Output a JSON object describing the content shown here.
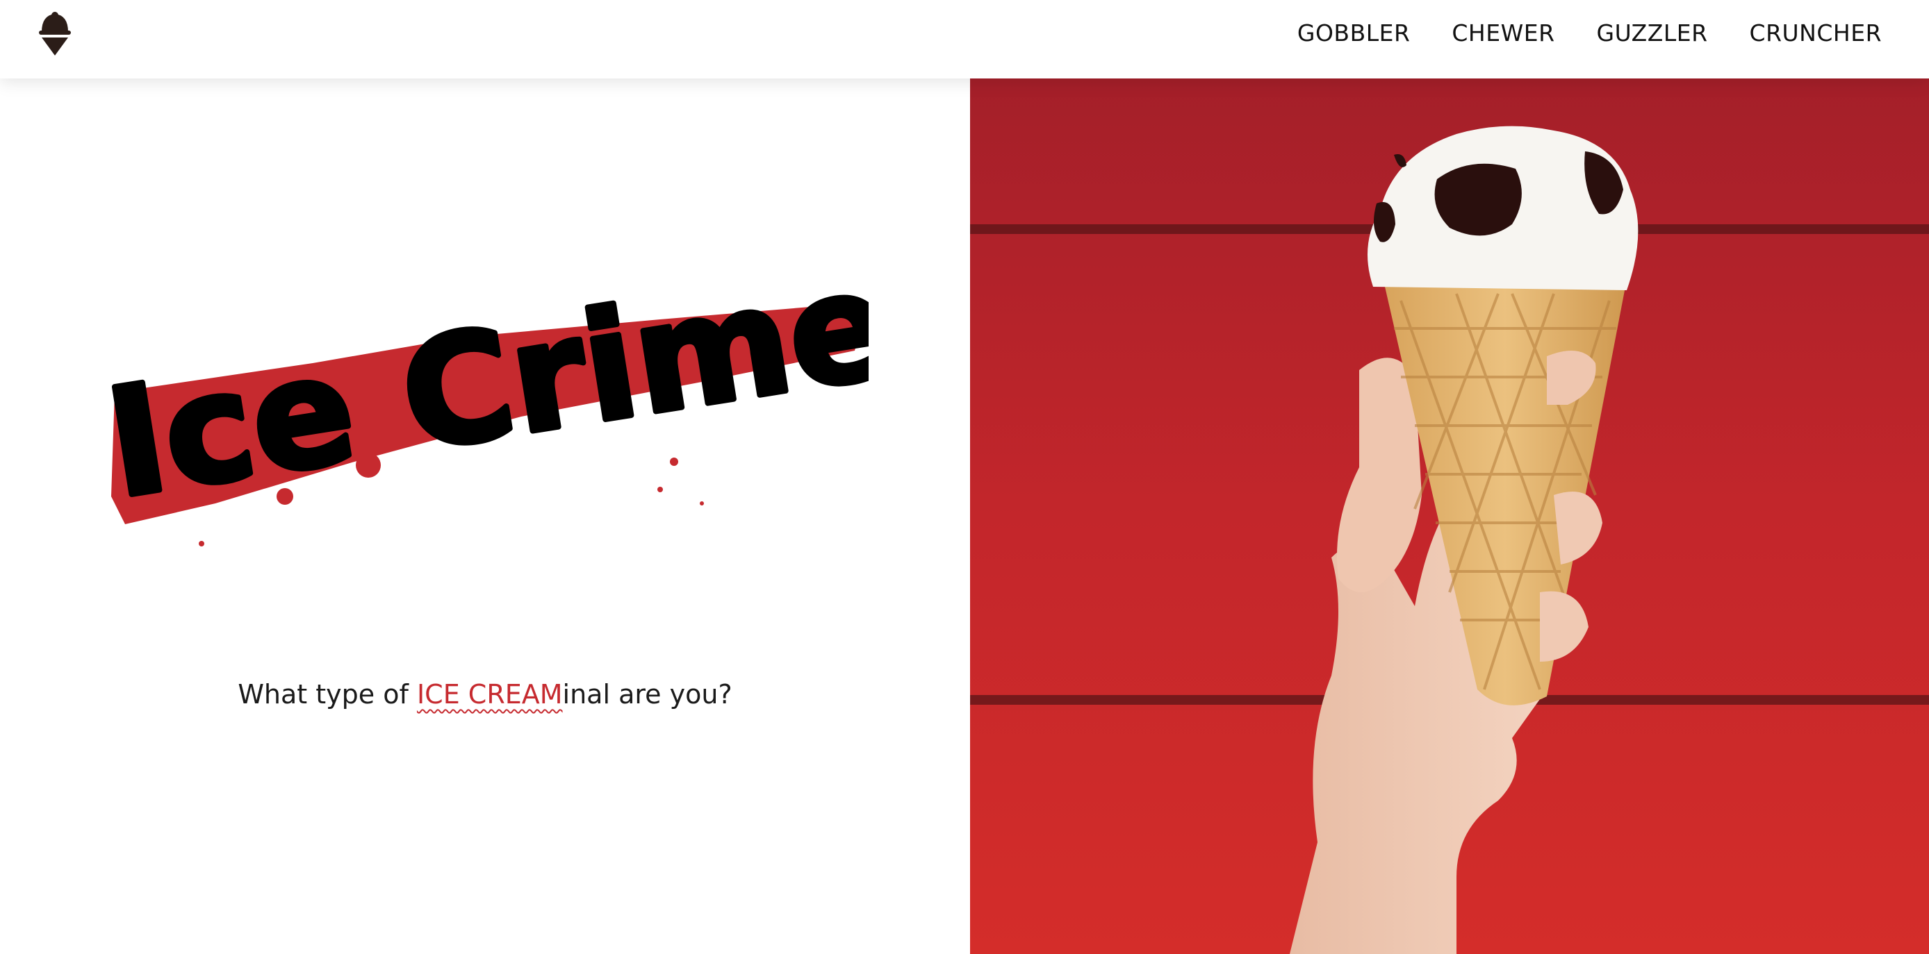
{
  "header": {
    "logo_icon": "ice-cream-cone-icon",
    "nav": [
      "GOBBLER",
      "CHEWER",
      "GUZZLER",
      "CRUNCHER"
    ]
  },
  "hero": {
    "title": "Ice Crime",
    "tagline_before": "What type of ",
    "tagline_highlight": "ICE CREAM",
    "tagline_after": "inal are you?"
  },
  "colors": {
    "accent_red": "#c62a2f",
    "wall_red": "#c9242a",
    "text": "#111111"
  },
  "photo": {
    "subject": "hand-holding-ice-cream-cone"
  }
}
